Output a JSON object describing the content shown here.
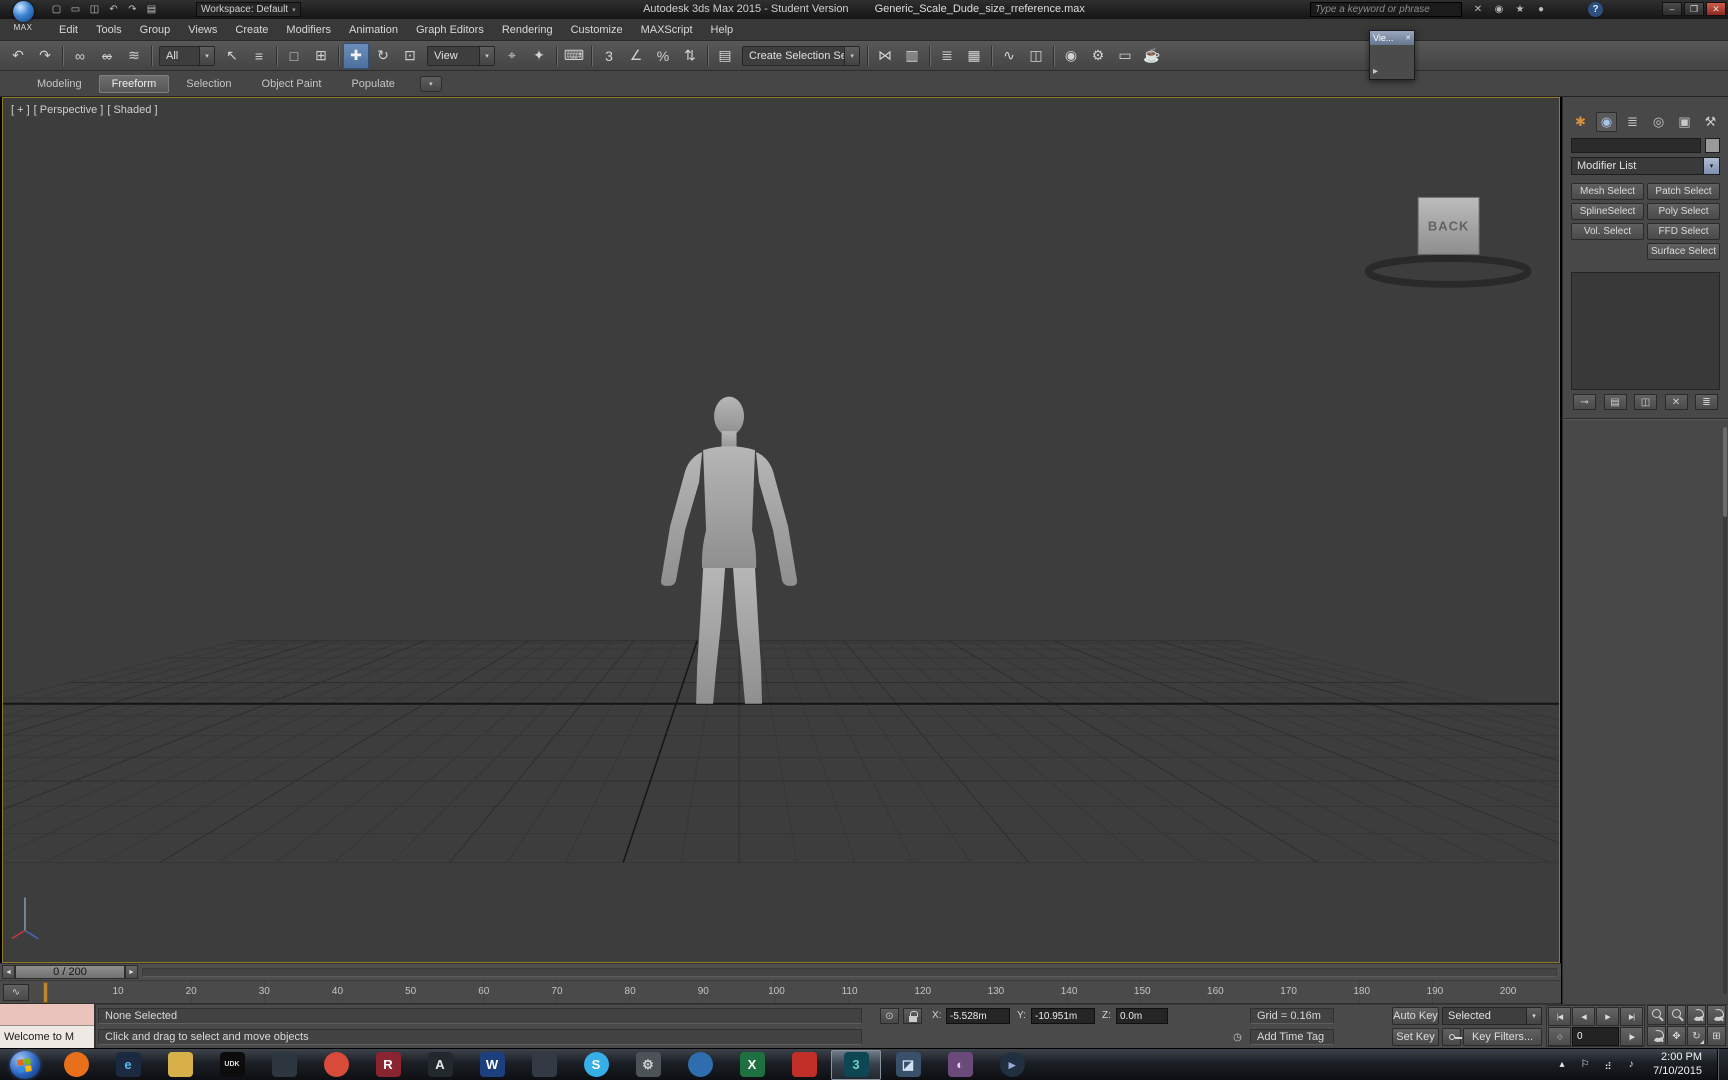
{
  "icons": {
    "dropdown_arrow": "▾"
  },
  "window": {
    "app_menu_label": "MAX",
    "workspace": "Workspace: Default",
    "app_title": "Autodesk 3ds Max 2015  - Student Version",
    "file_title": "Generic_Scale_Dude_size_rreference.max",
    "search_placeholder": "Type a keyword or phrase",
    "help_label": "?",
    "quick_access": [
      {
        "name": "new-scene-icon",
        "glyph": "▢"
      },
      {
        "name": "open-file-icon",
        "glyph": "▭"
      },
      {
        "name": "save-file-icon",
        "glyph": "◫"
      },
      {
        "name": "undo-small-icon",
        "glyph": "↶"
      },
      {
        "name": "redo-small-icon",
        "glyph": "↷"
      },
      {
        "name": "project-folder-icon",
        "glyph": "▤"
      }
    ],
    "infocenter_icons": [
      {
        "name": "exchange-apps-icon",
        "glyph": "✕"
      },
      {
        "name": "sign-in-icon",
        "glyph": "◉"
      },
      {
        "name": "favorites-star-icon",
        "glyph": "★"
      },
      {
        "name": "communication-center-icon",
        "glyph": "●"
      }
    ],
    "window_controls": [
      {
        "name": "minimize-button",
        "glyph": "–"
      },
      {
        "name": "maximize-button",
        "glyph": "❐"
      },
      {
        "name": "close-button",
        "glyph": "✕",
        "cls": "close"
      }
    ]
  },
  "menu": {
    "items": [
      {
        "label": "Edit"
      },
      {
        "label": "Tools"
      },
      {
        "label": "Group"
      },
      {
        "label": "Views"
      },
      {
        "label": "Create"
      },
      {
        "label": "Modifiers"
      },
      {
        "label": "Animation"
      },
      {
        "label": "Graph Editors"
      },
      {
        "label": "Rendering"
      },
      {
        "label": "Customize"
      },
      {
        "label": "MAXScript"
      },
      {
        "label": "Help"
      }
    ]
  },
  "toolbar": {
    "filter_value": "All",
    "coord_value": "View",
    "sets_value": "Create Selection Se",
    "groupA": [
      {
        "name": "undo-icon",
        "glyph": "↶"
      },
      {
        "name": "redo-icon",
        "glyph": "↷"
      },
      {
        "sep": true
      },
      {
        "name": "select-and-link-icon",
        "glyph": "∞"
      },
      {
        "name": "unlink-selection-icon",
        "glyph": "∞",
        "cls": "strike"
      },
      {
        "name": "bind-to-space-warp-icon",
        "glyph": "≋"
      },
      {
        "sep": true
      }
    ],
    "groupB": [
      {
        "name": "select-object-icon",
        "glyph": "↖"
      },
      {
        "name": "select-by-name-icon",
        "glyph": "≡"
      },
      {
        "sep": true
      },
      {
        "name": "rectangular-selection-region-icon",
        "glyph": "□"
      },
      {
        "name": "window-crossing-icon",
        "glyph": "⊞"
      },
      {
        "sep": true
      },
      {
        "name": "select-and-move-icon",
        "glyph": "✚",
        "active": true
      },
      {
        "name": "select-and-rotate-icon",
        "glyph": "↻"
      },
      {
        "name": "select-and-scale-icon",
        "glyph": "⊡"
      }
    ],
    "groupC": [
      {
        "name": "use-pivot-point-center-icon",
        "glyph": "⌖"
      },
      {
        "name": "select-and-manipulate-icon",
        "glyph": "✦"
      },
      {
        "sep": true
      },
      {
        "name": "keyboard-shortcut-override-icon",
        "glyph": "⌨"
      },
      {
        "sep": true
      },
      {
        "name": "snaps-toggle-icon",
        "glyph": "3"
      },
      {
        "name": "angle-snap-icon",
        "glyph": "∠"
      },
      {
        "name": "percent-snap-icon",
        "glyph": "%"
      },
      {
        "name": "spinner-snap-icon",
        "glyph": "⇅"
      },
      {
        "sep": true
      },
      {
        "name": "edit-named-selection-sets-icon",
        "glyph": "▤"
      }
    ],
    "groupD": [
      {
        "sep": true
      },
      {
        "name": "mirror-icon",
        "glyph": "⋈"
      },
      {
        "name": "align-icon",
        "glyph": "▥"
      },
      {
        "sep": true
      },
      {
        "name": "layer-explorer-icon",
        "glyph": "≣"
      },
      {
        "name": "ribbon-toggle-icon",
        "glyph": "▦"
      },
      {
        "sep": true
      },
      {
        "name": "curve-editor-icon",
        "glyph": "∿"
      },
      {
        "name": "schematic-view-icon",
        "glyph": "◫"
      },
      {
        "sep": true
      },
      {
        "name": "material-editor-icon",
        "glyph": "◉"
      },
      {
        "name": "render-setup-icon",
        "glyph": "⚙"
      },
      {
        "name": "rendered-frame-window-icon",
        "glyph": "▭"
      },
      {
        "name": "render-production-icon",
        "glyph": "☕"
      }
    ]
  },
  "ribbon": {
    "tabs": [
      {
        "label": "Modeling"
      },
      {
        "label": "Freeform",
        "active": true
      },
      {
        "label": "Selection"
      },
      {
        "label": "Object Paint"
      },
      {
        "label": "Populate"
      }
    ],
    "overflow_glyph": "▾"
  },
  "viewport": {
    "label_plus": "[ + ]",
    "label_view": "[ Perspective ]",
    "label_shading": "[ Shaded ]",
    "viewcube_label": "BACK",
    "floating_window": {
      "title": "Vie...",
      "close_glyph": "✕",
      "play_glyph": "▸"
    }
  },
  "command_panel": {
    "tabs": [
      {
        "name": "create-tab",
        "glyph": "✱",
        "fg": "#d8913c"
      },
      {
        "name": "modify-tab",
        "glyph": "◉",
        "fg": "#a9c6e8",
        "active": true
      },
      {
        "name": "hierarchy-tab",
        "glyph": "≣",
        "fg": "#c8c8c8"
      },
      {
        "name": "motion-tab",
        "glyph": "◎",
        "fg": "#c8c8c8"
      },
      {
        "name": "display-tab",
        "glyph": "▣",
        "fg": "#c8c8c8"
      },
      {
        "name": "utilities-tab",
        "glyph": "⚒",
        "fg": "#c8c8c8"
      }
    ],
    "object_name_value": "",
    "modifier_list_label": "Modifier List",
    "modifier_buttons": [
      {
        "label": "Mesh Select"
      },
      {
        "label": "Patch Select"
      },
      {
        "label": "SplineSelect"
      },
      {
        "label": "Poly Select"
      },
      {
        "label": "Vol. Select"
      },
      {
        "label": "FFD Select"
      },
      {
        "label": "",
        "blank": true
      },
      {
        "label": "Surface Select"
      }
    ],
    "stack_footer": [
      {
        "name": "pin-stack-icon",
        "glyph": "⊸"
      },
      {
        "name": "show-end-result-icon",
        "glyph": "▤"
      },
      {
        "name": "make-unique-icon",
        "glyph": "◫"
      },
      {
        "name": "remove-modifier-icon",
        "glyph": "✕"
      },
      {
        "name": "configure-modifier-sets-icon",
        "glyph": "≣"
      }
    ]
  },
  "timeline": {
    "prev_glyph": "◄",
    "next_glyph": "►",
    "slider_label": "0 / 200",
    "mini_curve_glyph": "∿",
    "ticks": [
      "10",
      "20",
      "30",
      "40",
      "50",
      "60",
      "70",
      "80",
      "90",
      "100",
      "110",
      "120",
      "130",
      "140",
      "150",
      "160",
      "170",
      "180",
      "190",
      "200"
    ]
  },
  "status": {
    "selection_status": "None Selected",
    "prompt": "Click and drag to select and move objects",
    "listener_text": "Welcome to M",
    "isolate_glyph": "⊙",
    "x_label": "X:",
    "x_value": "-5.528m",
    "y_label": "Y:",
    "y_value": "-10.951m",
    "z_label": "Z:",
    "z_value": "0.0m",
    "grid_value": "Grid = 0.16m",
    "time_tag_glyph": "◷",
    "add_time_tag": "Add Time Tag",
    "auto_key_label": "Auto Key",
    "set_key_label": "Set Key",
    "selected_value": "Selected",
    "key_filters_label": "Key Filters..."
  },
  "transport": {
    "row1": [
      {
        "name": "go-to-start-button",
        "glyph": "|◀"
      },
      {
        "name": "previous-frame-button",
        "glyph": "◀"
      },
      {
        "name": "play-animation-button",
        "glyph": "▶"
      },
      {
        "name": "go-to-end-button",
        "glyph": "▶|"
      }
    ],
    "key_mode_glyph": "◇",
    "frame_value": "0",
    "row2_end": [
      {
        "name": "next-frame-button",
        "glyph": "|▶"
      }
    ]
  },
  "nav": {
    "buttons": [
      {
        "name": "zoom-icon",
        "cls": "mag"
      },
      {
        "name": "zoom-all-icon",
        "cls": "mag"
      },
      {
        "name": "zoom-extents-icon",
        "cls": "mag",
        "fly": true
      },
      {
        "name": "zoom-extents-all-icon",
        "cls": "mag",
        "fly": true
      },
      {
        "name": "zoom-region-icon",
        "cls": "mag",
        "fly": true
      },
      {
        "name": "pan-view-icon",
        "glyph": "✥"
      },
      {
        "name": "orbit-icon",
        "glyph": "↻",
        "fly": true
      },
      {
        "name": "maximize-viewport-toggle-icon",
        "glyph": "⊞"
      }
    ]
  },
  "taskbar": {
    "start_flag": [
      {
        "bg": "#e06a1e"
      },
      {
        "bg": "#7fba00"
      },
      {
        "bg": "#2e8de0"
      },
      {
        "bg": "#ffb900"
      }
    ],
    "icons": [
      {
        "name": "firefox-icon",
        "bg": "#e8701a",
        "round": true,
        "text": ""
      },
      {
        "name": "internet-explorer-icon",
        "bg": "#1c2a40",
        "text": "e",
        "fg": "#52b8f0"
      },
      {
        "name": "file-explorer-icon",
        "bg": "#d8b04a",
        "text": ""
      },
      {
        "name": "udk-icon",
        "bg": "#0c0c0c",
        "text": "UDK",
        "fg": "#e0e0e0",
        "cls": "small"
      },
      {
        "name": "app-icon-dark",
        "bg": "#2e3640",
        "text": ""
      },
      {
        "name": "chrome-icon",
        "bg": "#d84a3a",
        "round": true,
        "text": ""
      },
      {
        "name": "app-icon-r",
        "bg": "#8a2430",
        "text": "R",
        "fg": "#ffffff"
      },
      {
        "name": "autodesk-app-icon",
        "bg": "#23272e",
        "text": "A",
        "fg": "#e8e8e8"
      },
      {
        "name": "word-icon",
        "bg": "#1e3f7e",
        "text": "W",
        "fg": "#ffffff"
      },
      {
        "name": "app-icon-dark-2",
        "bg": "#343a44",
        "text": ""
      },
      {
        "name": "skype-icon",
        "bg": "#36aee8",
        "round": true,
        "text": "S",
        "fg": "#ffffff"
      },
      {
        "name": "settings-gear-icon",
        "bg": "#4c5258",
        "text": "⚙",
        "fg": "#d0d0d0"
      },
      {
        "name": "globe-icon",
        "bg": "#2e6eae",
        "round": true,
        "text": ""
      },
      {
        "name": "excel-icon",
        "bg": "#1e7040",
        "text": "X",
        "fg": "#ffffff"
      },
      {
        "name": "app-icon-red",
        "bg": "#c03028",
        "text": ""
      },
      {
        "name": "3ds-max-icon",
        "bg": "#0f4654",
        "text": "3",
        "fg": "#6fd0c0",
        "active": true
      },
      {
        "name": "photo-viewer-icon",
        "bg": "#38506a",
        "text": "◪",
        "fg": "#cfe0f0"
      },
      {
        "name": "paint-icon",
        "bg": "#6a4a7a",
        "text": "◐",
        "fg": "#e8d0f0"
      },
      {
        "name": "media-player-icon",
        "bg": "#203040",
        "round": true,
        "text": "▸",
        "fg": "#99aadd"
      }
    ],
    "tray": {
      "chevron": "▴",
      "flag": "⚐",
      "network": "⣴",
      "volume": "♪",
      "time": "2:00 PM",
      "date": "7/10/2015"
    }
  }
}
